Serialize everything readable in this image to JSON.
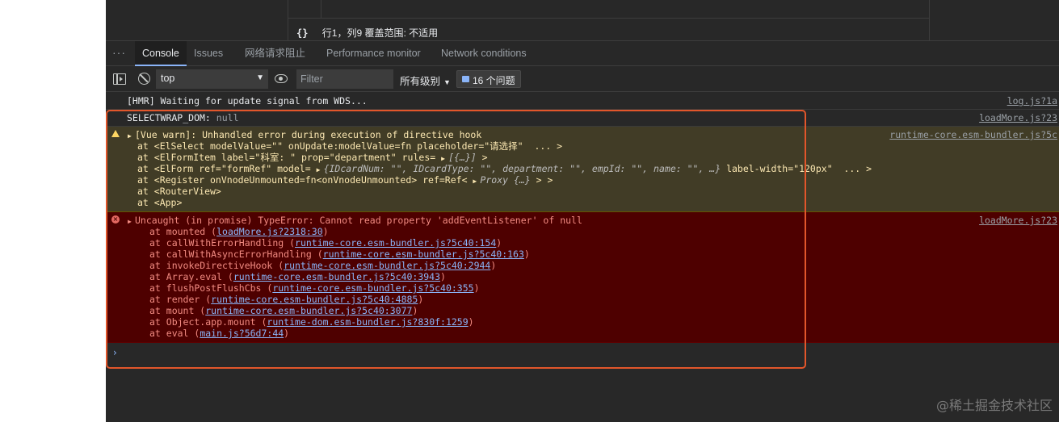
{
  "editor": {
    "braces": "{}",
    "status": "行1，列9   覆盖范围: 不适用"
  },
  "drawer": {
    "more": "···",
    "tabs": [
      {
        "label": "Console",
        "active": true
      },
      {
        "label": "Issues"
      },
      {
        "label": "网络请求阻止"
      },
      {
        "label": "Performance monitor"
      },
      {
        "label": "Network conditions"
      }
    ]
  },
  "toolbar": {
    "context": "top",
    "filter_placeholder": "Filter",
    "levels": "所有级别",
    "issues": "16 个问题"
  },
  "messages": {
    "hmr": {
      "text": "[HMR] Waiting for update signal from WDS...",
      "source": "log.js?1a"
    },
    "selectwrap": {
      "name": "SELECTWRAP_DOM:",
      "value": "null",
      "source": "loadMore.js?23"
    },
    "warn": {
      "source": "runtime-core.esm-bundler.js?5c",
      "lines": [
        "[Vue warn]: Unhandled error during execution of directive hook",
        "at <ElSelect modelValue=\"\" onUpdate:modelValue=fn placeholder=\"请选择\"  ... >",
        "at <ElFormItem label=\"科室: \" prop=\"department\" rules= ",
        "at <ElForm ref=\"formRef\" model= ",
        "at <Register onVnodeUnmounted=fn<onVnodeUnmounted> ref=Ref< ",
        "at <RouterView>",
        "at <App>"
      ],
      "rules_preview": "[{…}]",
      "rules_tail": " >",
      "model_preview": "{IDcardNum: \"\", IDcardType: \"\", department: \"\", empId: \"\", name: \"\", …}",
      "model_tail": " label-width=\"120px\"  ... >",
      "ref_preview": "Proxy {…}",
      "ref_tail": " > >"
    },
    "error": {
      "source": "loadMore.js?23",
      "title": "Uncaught (in promise) TypeError: Cannot read property 'addEventListener' of null",
      "stack": [
        {
          "fn": "at mounted (",
          "link": "loadMore.js?2318:30",
          "end": ")"
        },
        {
          "fn": "at callWithErrorHandling (",
          "link": "runtime-core.esm-bundler.js?5c40:154",
          "end": ")"
        },
        {
          "fn": "at callWithAsyncErrorHandling (",
          "link": "runtime-core.esm-bundler.js?5c40:163",
          "end": ")"
        },
        {
          "fn": "at invokeDirectiveHook (",
          "link": "runtime-core.esm-bundler.js?5c40:2944",
          "end": ")"
        },
        {
          "fn": "at Array.eval (",
          "link": "runtime-core.esm-bundler.js?5c40:3943",
          "end": ")"
        },
        {
          "fn": "at flushPostFlushCbs (",
          "link": "runtime-core.esm-bundler.js?5c40:355",
          "end": ")"
        },
        {
          "fn": "at render (",
          "link": "runtime-core.esm-bundler.js?5c40:4885",
          "end": ")"
        },
        {
          "fn": "at mount (",
          "link": "runtime-core.esm-bundler.js?5c40:3077",
          "end": ")"
        },
        {
          "fn": "at Object.app.mount (",
          "link": "runtime-dom.esm-bundler.js?830f:1259",
          "end": ")"
        },
        {
          "fn": "at eval (",
          "link": "main.js?56d7:44",
          "end": ")"
        }
      ]
    },
    "prompt": "›"
  },
  "colors": {
    "highlight": "#e2562b",
    "warn_bg": "#413c26",
    "error_bg": "#4e0000",
    "link": "#8ab4f8"
  },
  "watermark": "@稀土掘金技术社区"
}
